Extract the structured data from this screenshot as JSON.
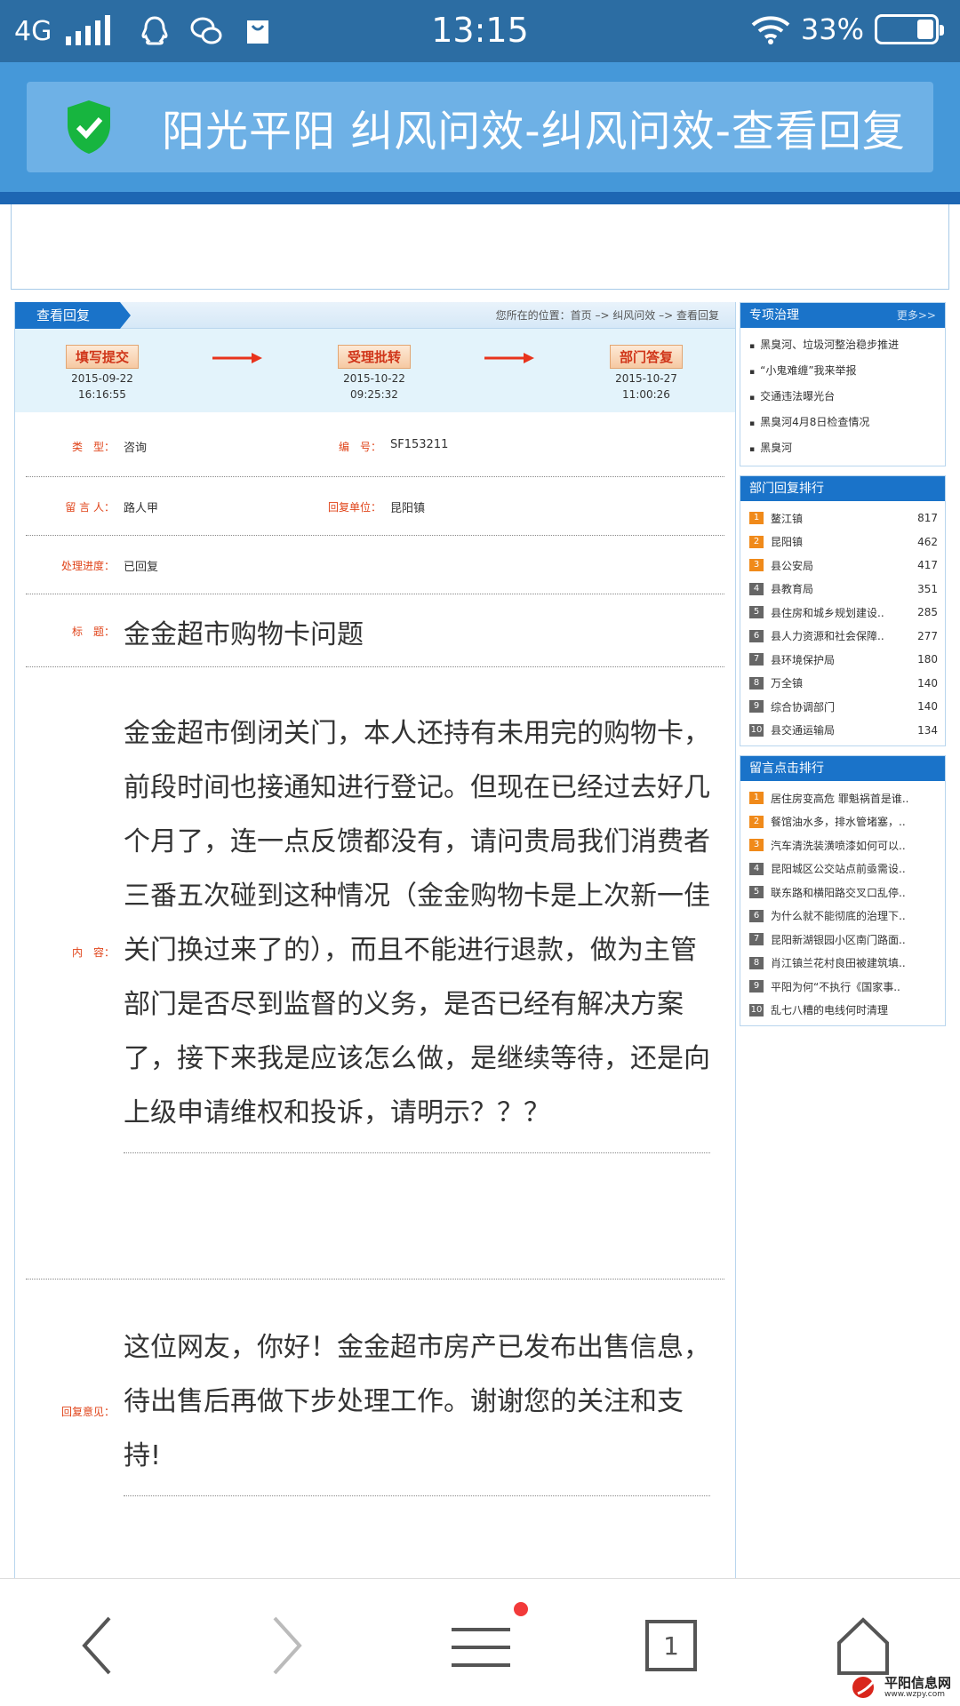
{
  "status_bar": {
    "network": "4G",
    "time": "13:15",
    "battery": "33%"
  },
  "title_bar": {
    "title": "阳光平阳 纠风问效-纠风问效-查看回复"
  },
  "main": {
    "tab_label": "查看回复",
    "breadcrumb": "您所在的位置：首页 –> 纠风问效 –> 查看回复",
    "steps": [
      {
        "label": "填写提交",
        "date": "2015-09-22",
        "time": "16:16:55"
      },
      {
        "label": "受理批转",
        "date": "2015-10-22",
        "time": "09:25:32"
      },
      {
        "label": "部门答复",
        "date": "2015-10-27",
        "time": "11:00:26"
      }
    ],
    "fields": {
      "type_label": "类　型：",
      "type_value": "咨询",
      "number_label": "编　号：",
      "number_value": "SF153211",
      "author_label": "留 言 人：",
      "author_value": "路人甲",
      "unit_label": "回复单位：",
      "unit_value": "昆阳镇",
      "progress_label": "处理进度：",
      "progress_value": "已回复",
      "subject_label": "标　题：",
      "subject_value": "金金超市购物卡问题",
      "content_label": "内　容：",
      "content_value": "金金超市倒闭关门，本人还持有未用完的购物卡，前段时间也接通知进行登记。但现在已经过去好几个月了，连一点反馈都没有，请问贵局我们消费者三番五次碰到这种情况（金金购物卡是上次新一佳关门换过来了的），而且不能进行退款，做为主管部门是否尽到监督的义务，是否已经有解决方案了，接下来我是应该怎么做，是继续等待，还是向上级申请维权和投诉，请明示？？？",
      "reply_label": "回复意见：",
      "reply_value": "这位网友，你好！金金超市房产已发布出售信息，待出售后再做下步处理工作。谢谢您的关注和支持!"
    }
  },
  "sidebar": {
    "special": {
      "title": "专项治理",
      "more": "更多>>",
      "items": [
        "黑臭河、垃圾河整治稳步推进",
        "“小鬼难缠”我来举报",
        "交通违法曝光台",
        "黑臭河4月8日检查情况",
        "黑臭河"
      ]
    },
    "dept_rank": {
      "title": "部门回复排行",
      "items": [
        {
          "num": "1",
          "name": "鳌江镇",
          "count": "817"
        },
        {
          "num": "2",
          "name": "昆阳镇",
          "count": "462"
        },
        {
          "num": "3",
          "name": "县公安局",
          "count": "417"
        },
        {
          "num": "4",
          "name": "县教育局",
          "count": "351"
        },
        {
          "num": "5",
          "name": "县住房和城乡规划建设..",
          "count": "285"
        },
        {
          "num": "6",
          "name": "县人力资源和社会保障..",
          "count": "277"
        },
        {
          "num": "7",
          "name": "县环境保护局",
          "count": "180"
        },
        {
          "num": "8",
          "name": "万全镇",
          "count": "140"
        },
        {
          "num": "9",
          "name": "综合协调部门",
          "count": "140"
        },
        {
          "num": "10",
          "name": "县交通运输局",
          "count": "134"
        }
      ]
    },
    "click_rank": {
      "title": "留言点击排行",
      "items": [
        {
          "num": "1",
          "name": "居住房变高危 罪魁祸首是谁.."
        },
        {
          "num": "2",
          "name": "餐馆油水多，排水管堵塞，.."
        },
        {
          "num": "3",
          "name": "汽车清洗装潢喷漆如何可以.."
        },
        {
          "num": "4",
          "name": "昆阳城区公交站点前亟需设.."
        },
        {
          "num": "5",
          "name": "联东路和横阳路交叉口乱停.."
        },
        {
          "num": "6",
          "name": "为什么就不能彻底的治理下.."
        },
        {
          "num": "7",
          "name": "昆阳新湖银园小区南门路面.."
        },
        {
          "num": "8",
          "name": "肖江镇兰花村良田被建筑填.."
        },
        {
          "num": "9",
          "name": "平阳为何“不执行《国家事.."
        },
        {
          "num": "10",
          "name": "乱七八糟的电线何时清理"
        }
      ]
    }
  },
  "bottom_nav": {
    "tab_count": "1",
    "watermark_name": "平阳信息网",
    "watermark_url": "www.wzpy.com"
  }
}
